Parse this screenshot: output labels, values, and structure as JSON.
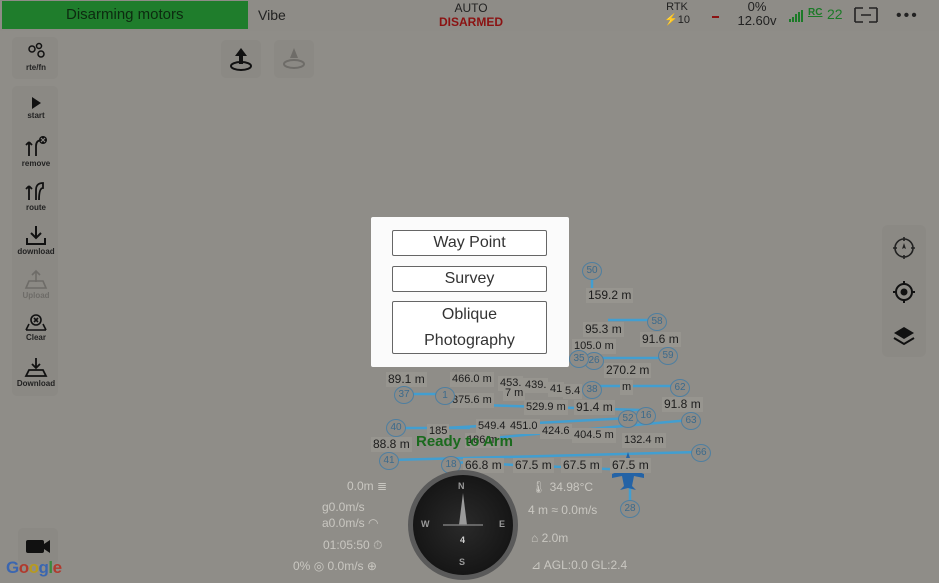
{
  "topbar": {
    "status_banner": "Disarming motors",
    "vehicle_name": "Vibe",
    "flight_mode": "AUTO",
    "arm_state": "DISARMED",
    "rtk_label": "RTK",
    "rtk_sats": "10",
    "battery_percent": "0%",
    "battery_voltage": "12.60v",
    "rc_label": "RC",
    "rc_value": "22",
    "more_label": "•••"
  },
  "left_toolbar": {
    "rte_fn": "rte/fn",
    "start": "start",
    "remove": "remove",
    "route": "route",
    "download": "download",
    "upload": "Upload",
    "clear": "Clear",
    "download2": "Download"
  },
  "dialog": {
    "way_point": "Way Point",
    "survey": "Survey",
    "oblique_line1": "Oblique",
    "oblique_line2": "Photography"
  },
  "map": {
    "ready_text": "Ready to Arm",
    "labels": [
      {
        "text": "159.2 m"
      },
      {
        "text": "95.3 m"
      },
      {
        "text": "105.0 m"
      },
      {
        "text": "91.6 m"
      },
      {
        "text": "270.2 m"
      },
      {
        "text": "89.1 m"
      },
      {
        "text": "466.0 m"
      },
      {
        "text": "453."
      },
      {
        "text": "439."
      },
      {
        "text": "41"
      },
      {
        "text": "5.4"
      },
      {
        "text": "m"
      },
      {
        "text": "375.6 m"
      },
      {
        "text": "7 m"
      },
      {
        "text": "529.9 m"
      },
      {
        "text": "91.4 m"
      },
      {
        "text": "91.8 m"
      },
      {
        "text": "549.4"
      },
      {
        "text": "451.0"
      },
      {
        "text": "424.6"
      },
      {
        "text": "404.5 m"
      },
      {
        "text": "132.4 m"
      },
      {
        "text": "88.8 m"
      },
      {
        "text": "66.8 m"
      },
      {
        "text": "67.5 m"
      },
      {
        "text": "67.5 m"
      },
      {
        "text": "67.5 m"
      },
      {
        "text": "185"
      },
      {
        "text": "186 m"
      }
    ],
    "waypoints": [
      "50",
      "58",
      "59",
      "62",
      "63",
      "66",
      "37",
      "40",
      "41",
      "18",
      "52",
      "16",
      "28",
      "29",
      "26",
      "35",
      "38",
      "1"
    ]
  },
  "telemetry": {
    "altitude": "0.0m",
    "ground_speed": "g0.0m/s",
    "air_speed": "a0.0m/s",
    "flight_time": "01:05:50",
    "throttle": "0%",
    "vertical_speed": "0.0m/s",
    "temperature": "34.98°C",
    "distance": "4 m",
    "wind": "0.0m/s",
    "dist_to_home": "2.0m",
    "agl": "AGL:0.0",
    "gl": "GL:2.4",
    "compass_n": "N",
    "compass_s": "S",
    "compass_e": "E",
    "compass_w": "W",
    "compass_value": "29",
    "compass_bottom": "4"
  },
  "google_logo": "Google",
  "colors": {
    "banner_green": "#1f7d2c",
    "disarmed_red": "#8b1212",
    "rc_green": "#1b7a27",
    "waypoint_blue": "#4f7fa0",
    "route_line": "#3aa0d8"
  }
}
